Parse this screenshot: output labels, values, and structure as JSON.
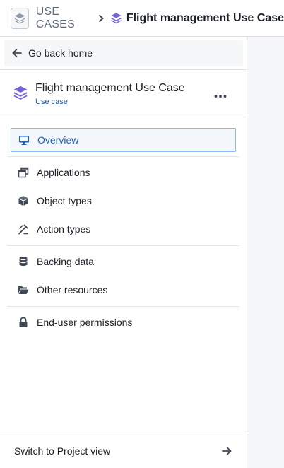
{
  "breadcrumb": {
    "root": "USE CASES",
    "current": "Flight management Use Case"
  },
  "sidebar": {
    "back_label": "Go back home",
    "use_case": {
      "title": "Flight management Use Case",
      "subtitle": "Use case"
    },
    "nav": [
      {
        "label": "Overview",
        "icon": "monitor-icon",
        "active": true
      },
      {
        "label": "Applications",
        "icon": "applications-icon"
      },
      {
        "label": "Object types",
        "icon": "cube-icon"
      },
      {
        "label": "Action types",
        "icon": "action-types-icon"
      },
      {
        "label": "Backing data",
        "icon": "database-icon"
      },
      {
        "label": "Other resources",
        "icon": "folder-open-icon"
      },
      {
        "label": "End-user permissions",
        "icon": "lock-icon"
      }
    ],
    "footer_label": "Switch to Project view"
  },
  "colors": {
    "accent": "#215db0",
    "layers_icon": "#7961db",
    "active_border": "#8abbff"
  }
}
